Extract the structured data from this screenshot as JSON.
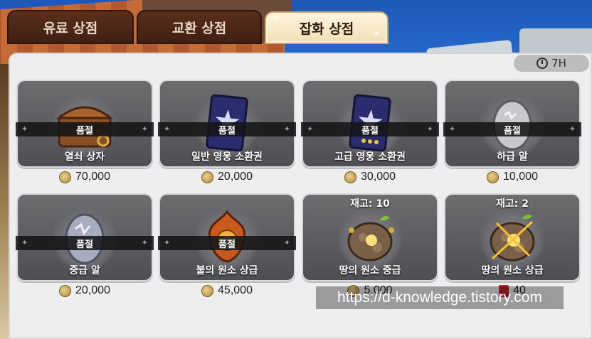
{
  "tabs": [
    {
      "label": "유료 상점",
      "active": false
    },
    {
      "label": "교환 상점",
      "active": false
    },
    {
      "label": "잡화 상점",
      "active": true
    }
  ],
  "timer": {
    "label": "7H",
    "icon": "stopwatch-icon"
  },
  "items": [
    {
      "name": "열쇠 상자",
      "price": "70,000",
      "currency": "gold-coin",
      "status": "품절",
      "icon": "treasure-chest-icon"
    },
    {
      "name": "일반 영웅 소환권",
      "price": "20,000",
      "currency": "gold-coin",
      "status": "품절",
      "icon": "hero-summon-card-icon"
    },
    {
      "name": "고급 영웅 소환권",
      "price": "30,000",
      "currency": "gold-coin",
      "status": "품절",
      "icon": "premium-hero-summon-card-icon"
    },
    {
      "name": "하급 알",
      "price": "10,000",
      "currency": "gold-coin",
      "status": "품절",
      "icon": "low-egg-icon"
    },
    {
      "name": "중급 알",
      "price": "20,000",
      "currency": "gold-coin",
      "status": "품절",
      "icon": "mid-egg-icon"
    },
    {
      "name": "불의 원소 상급",
      "price": "45,000",
      "currency": "gold-coin",
      "status": "품절",
      "icon": "fire-element-icon"
    },
    {
      "name": "땅의 원소 중급",
      "price": "5,000",
      "currency": "gold-coin",
      "stock": "재고: 10",
      "icon": "earth-element-icon"
    },
    {
      "name": "땅의 원소 상급",
      "price": "40",
      "currency": "ruby-gem",
      "stock": "재고: 2",
      "icon": "earth-element-high-icon"
    }
  ],
  "watermark": "https://d-knowledge.tistory.com",
  "colors": {
    "card_bg": "#5e5e62",
    "panel_bg": "#eeeeee",
    "active_tab": "#fff6df",
    "inactive_tab": "#4a2416"
  }
}
